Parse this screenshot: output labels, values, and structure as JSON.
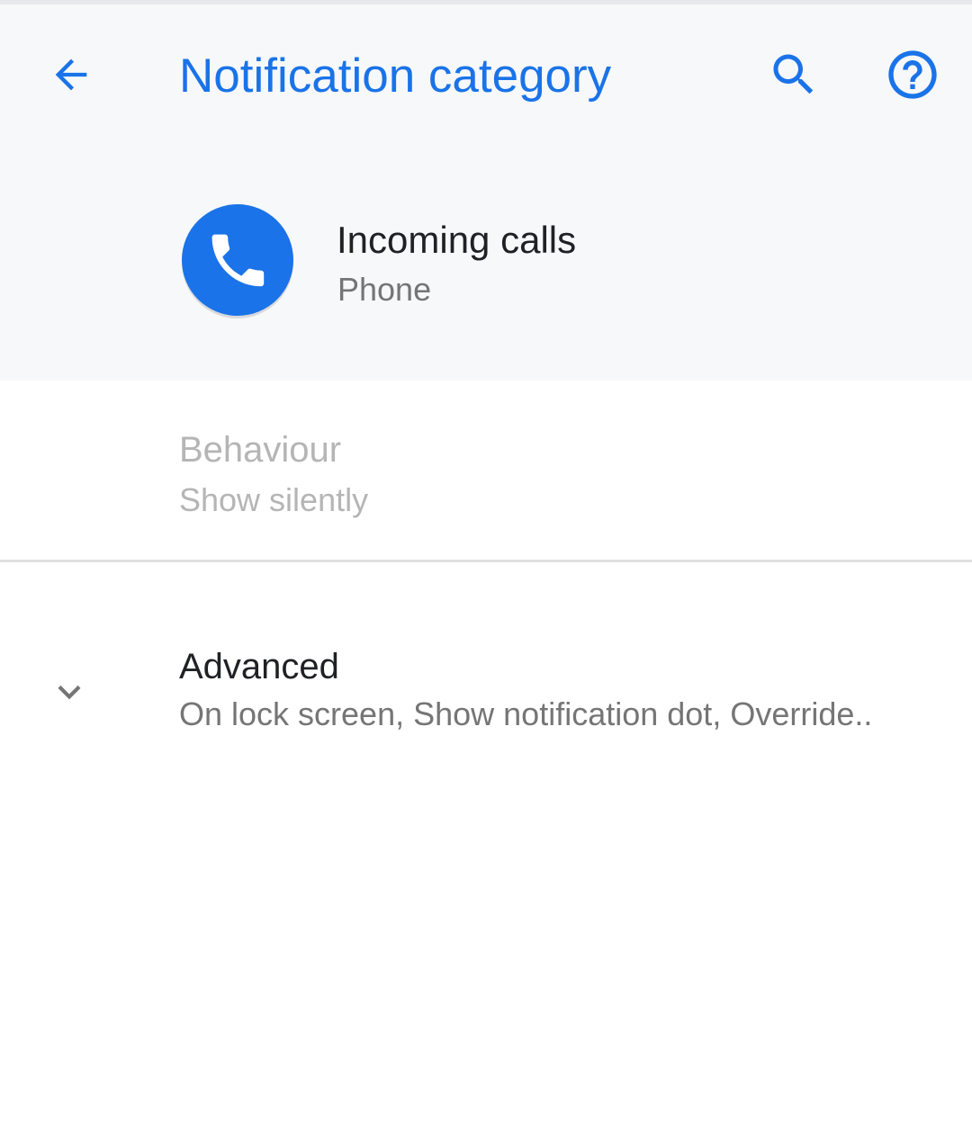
{
  "toolbar": {
    "title": "Notification category",
    "back_icon": "arrow-back-icon",
    "search_icon": "search-icon",
    "help_icon": "help-circle-icon"
  },
  "app_header": {
    "title": "Incoming calls",
    "subtitle": "Phone",
    "icon": "phone-app-icon"
  },
  "preferences": {
    "behaviour": {
      "title": "Behaviour",
      "summary": "Show silently",
      "enabled": false
    },
    "advanced": {
      "title": "Advanced",
      "summary": "On lock screen, Show notification dot, Override..",
      "icon": "chevron-down-icon"
    }
  },
  "colors": {
    "accent": "#1a73e8",
    "header_background": "#f7f8fa",
    "primary_text": "#202124",
    "secondary_text": "#757575",
    "disabled_text": "#b5b5b5"
  }
}
